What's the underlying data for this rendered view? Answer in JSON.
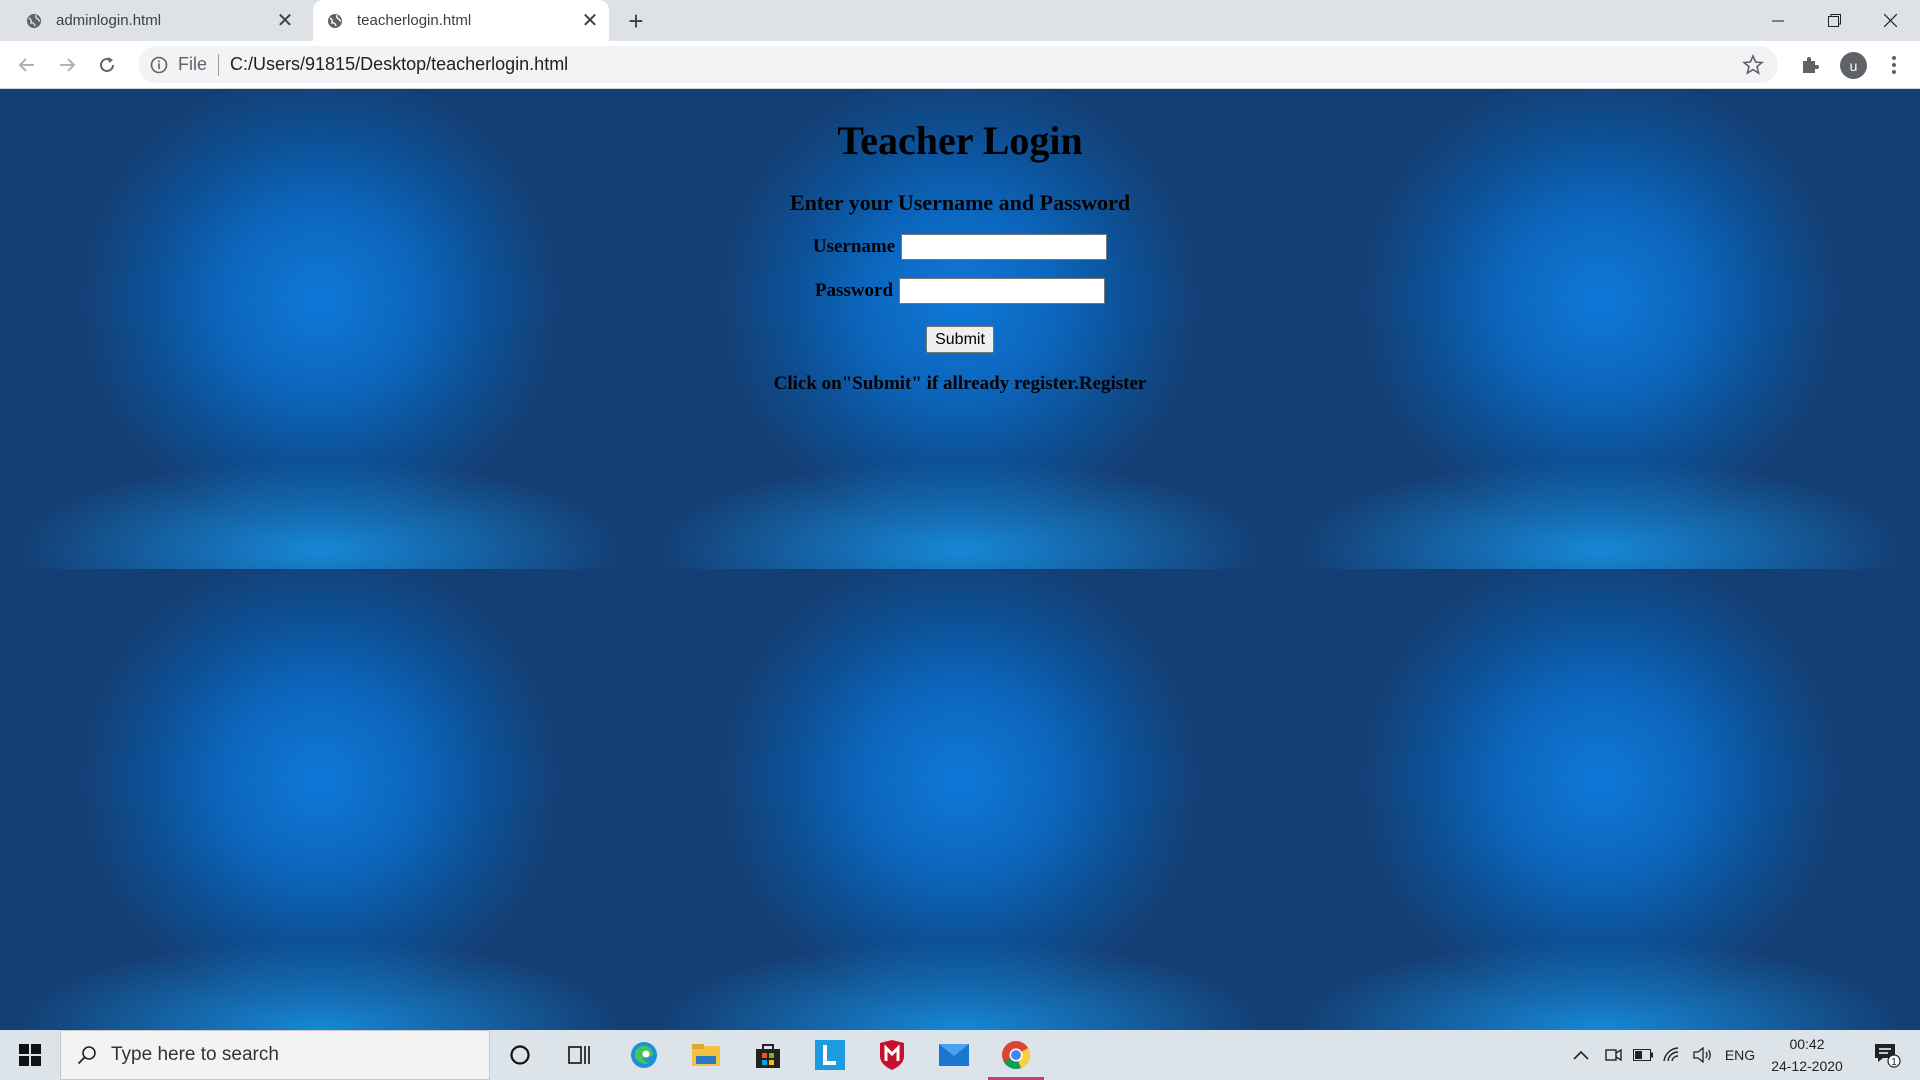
{
  "browser": {
    "tabs": [
      {
        "title": "adminlogin.html",
        "active": false
      },
      {
        "title": "teacherlogin.html",
        "active": true
      }
    ],
    "address": {
      "scheme": "File",
      "url": "C:/Users/91815/Desktop/teacherlogin.html"
    },
    "profile_initial": "u"
  },
  "page": {
    "title": "Teacher Login",
    "subtitle": "Enter your Username and Password",
    "username_label": "Username",
    "password_label": "Password",
    "username_value": "",
    "password_value": "",
    "submit_label": "Submit",
    "note_prefix": "Click on\"Submit\" if allready register.",
    "note_link": "Register"
  },
  "taskbar": {
    "search_placeholder": "Type here to search",
    "apps": [
      "cortana-icon",
      "task-view-icon",
      "edge-icon",
      "file-explorer-icon",
      "store-icon",
      "app-l-icon",
      "mcafee-icon",
      "mail-icon",
      "chrome-icon"
    ],
    "language": "ENG",
    "time": "00:42",
    "date": "24-12-2020",
    "notification_count": "1"
  },
  "colors": {
    "page_bg": "#0c66bd",
    "taskbar_bg": "#dde4e9",
    "active_indicator": "#d0387a"
  }
}
